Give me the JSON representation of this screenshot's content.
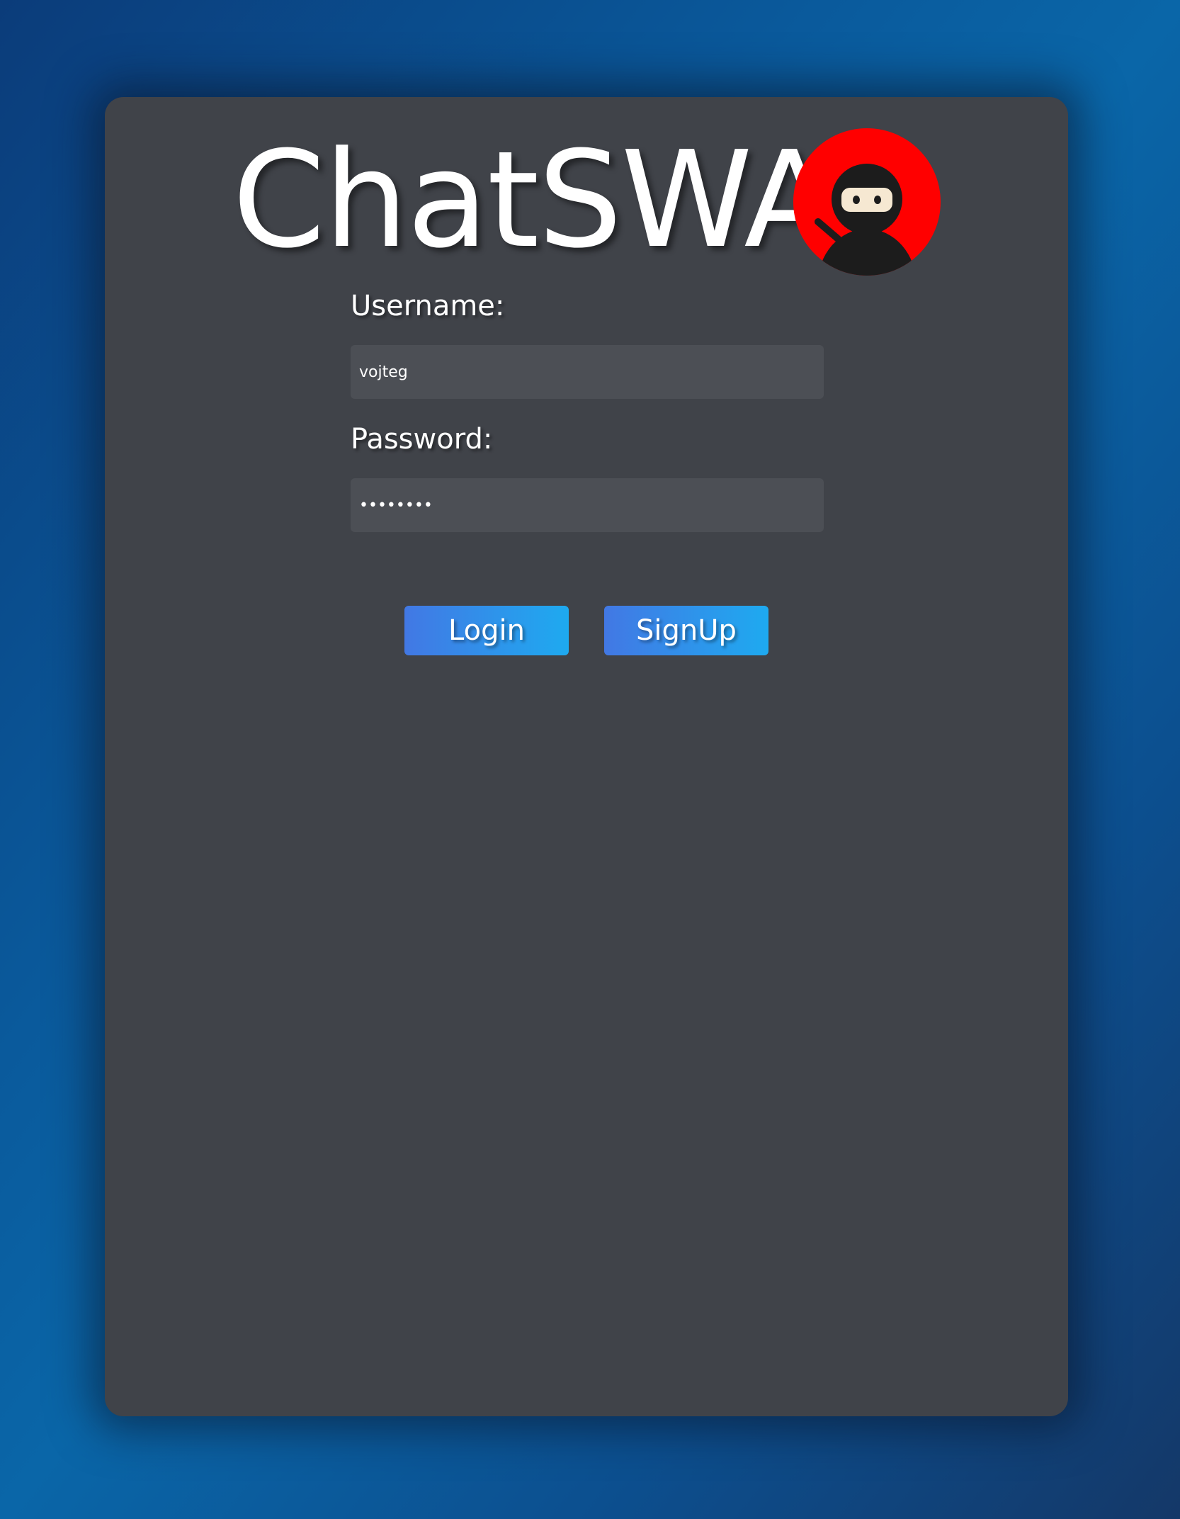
{
  "app": {
    "title": "ChatSWA",
    "logo_icon": "ninja-avatar-icon"
  },
  "form": {
    "username_label": "Username:",
    "username_value": "vojteg",
    "password_label": "Password:",
    "password_value": "12345678"
  },
  "actions": {
    "login_label": "Login",
    "signup_label": "SignUp"
  },
  "colors": {
    "card_background": "#404349",
    "field_background": "#4c4f55",
    "button_gradient_start": "#4278e4",
    "button_gradient_end": "#1eaaf0",
    "logo_background": "#ff0000"
  }
}
